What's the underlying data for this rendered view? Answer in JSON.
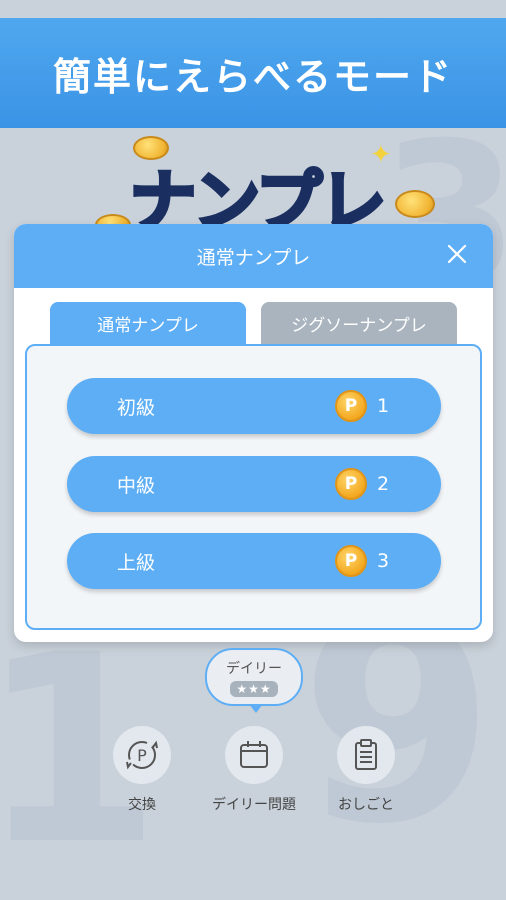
{
  "banner": {
    "title": "簡単にえらべるモード"
  },
  "logo": {
    "text": "ナンプレ",
    "coin_symbol": "P"
  },
  "modal": {
    "title": "通常ナンプレ",
    "close_icon": "close-icon",
    "tabs": [
      {
        "label": "通常ナンプレ",
        "active": true
      },
      {
        "label": "ジグソーナンプレ",
        "active": false
      }
    ],
    "levels": [
      {
        "label": "初級",
        "coin_symbol": "P",
        "cost": "1"
      },
      {
        "label": "中級",
        "coin_symbol": "P",
        "cost": "2"
      },
      {
        "label": "上級",
        "coin_symbol": "P",
        "cost": "3"
      }
    ]
  },
  "bottom": {
    "daily_bubble": {
      "label": "デイリー",
      "stars": "★★★"
    },
    "nav": [
      {
        "label": "交換",
        "icon": "exchange-icon"
      },
      {
        "label": "デイリー問題",
        "icon": "calendar-icon"
      },
      {
        "label": "おしごと",
        "icon": "clipboard-icon"
      }
    ]
  },
  "colors": {
    "accent": "#5eaef5",
    "banner": "#3b93e6",
    "inactive_tab": "#a9b4be",
    "coin": "#f3a820",
    "background": "#c9d1da"
  }
}
